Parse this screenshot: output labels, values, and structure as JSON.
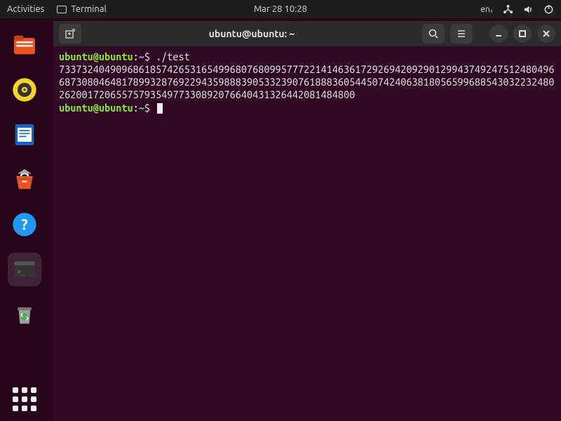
{
  "topbar": {
    "activities": "Activities",
    "app_name": "Terminal",
    "datetime": "Mar 28  10:28",
    "language": "en₁"
  },
  "dock": {
    "items": [
      {
        "name": "files-icon"
      },
      {
        "name": "rhythmbox-icon"
      },
      {
        "name": "libreoffice-writer-icon"
      },
      {
        "name": "software-center-icon"
      },
      {
        "name": "help-icon"
      },
      {
        "name": "terminal-icon"
      },
      {
        "name": "trash-icon"
      }
    ]
  },
  "window": {
    "title": "ubuntu@ubuntu: ~"
  },
  "terminal": {
    "prompt_user": "ubuntu@ubuntu",
    "prompt_path": "~",
    "prompt_symbol": "$",
    "command1": "./test",
    "output": "7337324049096861857426531654996807680995777221414636172926942092901299437492475124804966873080464817899328769229435988839053323907618883605445074240638180565996885430322324802620017206557579354977330892076640431326442081484800",
    "command2": ""
  }
}
